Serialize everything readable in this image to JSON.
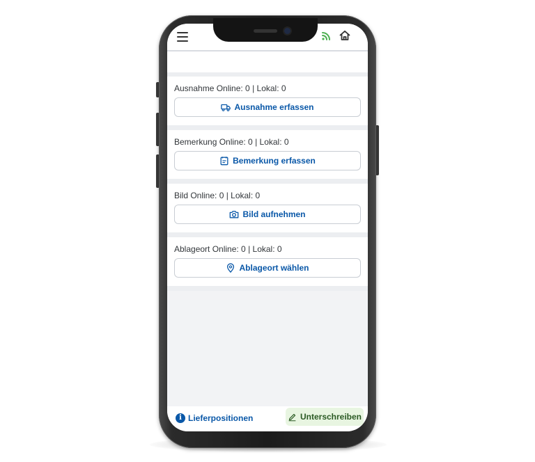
{
  "header": {
    "menu_icon": "hamburger-menu-icon",
    "connection_icon": "connection-signal-icon",
    "home_icon": "home-icon",
    "colors": {
      "connection": "#4caf50",
      "icon": "#333333"
    }
  },
  "sections": [
    {
      "label": "Ausnahme Online: 0 | Lokal: 0",
      "button_label": "Ausnahme erfassen",
      "icon": "truck-icon"
    },
    {
      "label": "Bemerkung Online: 0 | Lokal: 0",
      "button_label": "Bemerkung erfassen",
      "icon": "note-icon"
    },
    {
      "label": "Bild Online: 0 | Lokal: 0",
      "button_label": "Bild aufnehmen",
      "icon": "camera-icon"
    },
    {
      "label": "Ablageort Online: 0 | Lokal: 0",
      "button_label": "Ablageort wählen",
      "icon": "location-pin-icon"
    }
  ],
  "footer": {
    "left_label": "Lieferpositionen",
    "left_icon": "info-icon",
    "right_label": "Unterschreiben",
    "right_icon": "pen-icon"
  },
  "colors": {
    "accent": "#0a58a8",
    "sign_bg": "#e8f5e1",
    "sign_text": "#2b5a24",
    "page_bg": "#f2f3f5"
  }
}
